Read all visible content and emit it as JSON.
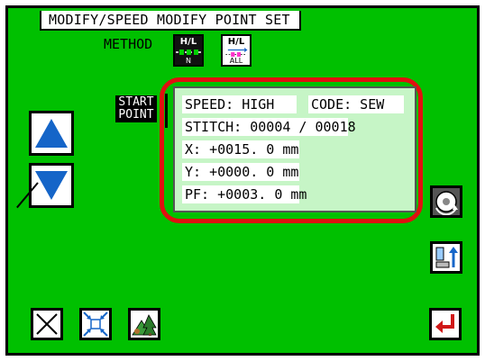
{
  "header": {
    "title": "MODIFY/SPEED MODIFY  POINT SET"
  },
  "method": {
    "label": "METHOD",
    "buttons": [
      {
        "label": "H/L",
        "sub": "N",
        "active": true
      },
      {
        "label": "H/L",
        "sub": "ALL",
        "active": false
      }
    ]
  },
  "start_point": {
    "line1": "START",
    "line2": "POINT"
  },
  "info": {
    "speed": "SPEED:  HIGH",
    "code": "CODE: SEW",
    "stitch": "STITCH: 00004 / 00018",
    "x": "X:   +0015. 0 mm",
    "y": "Y:   +0000. 0 mm",
    "pf": "PF: +0003. 0 mm"
  },
  "colors": {
    "background": "#00c000",
    "highlight": "#e01010",
    "info_bg": "#c6f5c6",
    "arrow_blue": "#1565c8",
    "enter_red": "#d01818"
  },
  "icons": {
    "up": "triangle-up-icon",
    "down": "triangle-down-icon",
    "rotate": "presser-rotate-icon",
    "presser_up": "presser-up-icon",
    "cancel": "x-icon",
    "zoom": "zoom-icon",
    "scenery": "scenery-icon",
    "enter": "enter-icon"
  }
}
